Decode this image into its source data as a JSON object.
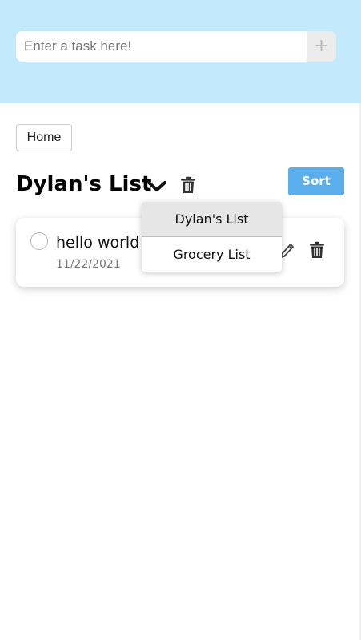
{
  "header": {
    "task_input": {
      "placeholder": "Enter a task here!",
      "value": ""
    },
    "add_label": "+"
  },
  "nav": {
    "home_label": "Home"
  },
  "list": {
    "title": "Dylan's List",
    "sort_label": "Sort"
  },
  "tasks": [
    {
      "name": "hello world",
      "date": "11/22/2021",
      "completed": false
    }
  ],
  "dropdown": {
    "options": [
      "Dylan's List",
      "Grocery List"
    ],
    "selected": "Dylan's List"
  },
  "icons": {
    "dropdown_toggle": "chevron-down-icon",
    "delete_list": "trash-icon",
    "edit_task": "pencil-icon",
    "delete_task": "trash-icon"
  },
  "colors": {
    "header_bg": "#c3e9fd",
    "sort_button": "#5aaeec",
    "add_button": "#ececec"
  }
}
